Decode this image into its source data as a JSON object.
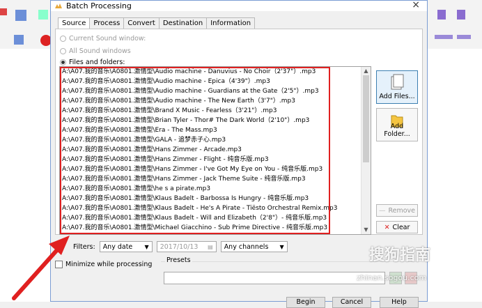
{
  "window": {
    "title": "Batch Processing",
    "close_glyph": "×"
  },
  "tabs": [
    {
      "label": "Source",
      "active": true
    },
    {
      "label": "Process"
    },
    {
      "label": "Convert"
    },
    {
      "label": "Destination"
    },
    {
      "label": "Information"
    }
  ],
  "source_options": {
    "current_sound_window": "Current Sound window:",
    "all_sound_windows": "All Sound windows",
    "files_and_folders": "Files and folders:"
  },
  "files": [
    "A:\\A07.我的音乐\\A0801.激情型\\Audio machine - Danuvius - No Choir（2'37\"）.mp3",
    "A:\\A07.我的音乐\\A0801.激情型\\Audio machine - Epica（4'39\"）.mp3",
    "A:\\A07.我的音乐\\A0801.激情型\\Audio machine - Guardians at the Gate（2'5\"）.mp3",
    "A:\\A07.我的音乐\\A0801.激情型\\Audio machine - The New Earth（3'7\"）.mp3",
    "A:\\A07.我的音乐\\A0801.激情型\\Brand X Music - Fearless（3'21\"）.mp3",
    "A:\\A07.我的音乐\\A0801.激情型\\Brian Tyler - Thor# The Dark World（2'10\"）.mp3",
    "A:\\A07.我的音乐\\A0801.激情型\\Era - The Mass.mp3",
    "A:\\A07.我的音乐\\A0801.激情型\\GALA - 追梦赤子心.mp3",
    "A:\\A07.我的音乐\\A0801.激情型\\Hans Zimmer - Arcade.mp3",
    "A:\\A07.我的音乐\\A0801.激情型\\Hans Zimmer - Flight - 纯音乐版.mp3",
    "A:\\A07.我的音乐\\A0801.激情型\\Hans Zimmer - I've Got My Eye on You - 纯音乐版.mp3",
    "A:\\A07.我的音乐\\A0801.激情型\\Hans Zimmer - Jack Theme Suite - 纯音乐版.mp3",
    "A:\\A07.我的音乐\\A0801.激情型\\he s a pirate.mp3",
    "A:\\A07.我的音乐\\A0801.激情型\\Klaus Badelt - Barbossa Is Hungry - 纯音乐版.mp3",
    "A:\\A07.我的音乐\\A0801.激情型\\Klaus Badelt - He's A Pirate - Tiësto Orchestral Remix.mp3",
    "A:\\A07.我的音乐\\A0801.激情型\\Klaus Badelt - Will and Elizabeth（2'8\"）- 纯音乐版.mp3",
    "A:\\A07.我的音乐\\A0801.激情型\\Michael Giacchino - Sub Prime Directive - 纯音乐版.mp3"
  ],
  "buttons": {
    "add_files": "Add Files...",
    "add_folder": "Add Folder...",
    "remove": "Remove",
    "clear": "Clear",
    "begin": "Begin",
    "cancel": "Cancel",
    "help": "Help"
  },
  "filters": {
    "label": "Filters:",
    "date_option": "Any date",
    "date_value": "2017/10/13",
    "channels_option": "Any channels"
  },
  "minimize_label": "Minimize while processing",
  "presets_label": "Presets",
  "watermark": {
    "brand": "搜狗指南",
    "url": "zhinan.sogou.com"
  },
  "colors": {
    "highlight": "#e02020",
    "arrow": "#e02020",
    "selected_button": "#e5f1fb"
  }
}
